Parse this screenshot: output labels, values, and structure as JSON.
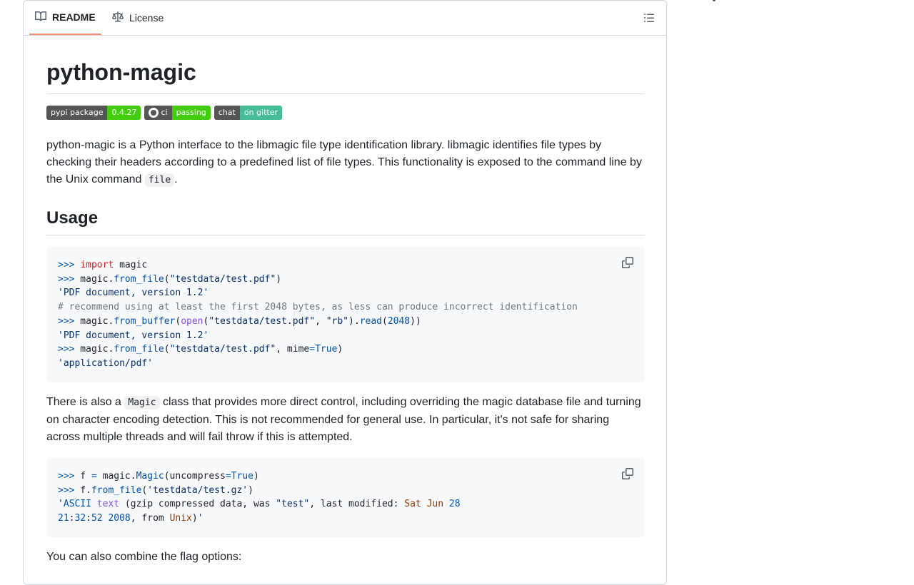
{
  "tabs": {
    "readme": {
      "label": "README",
      "icon": "book-icon"
    },
    "license": {
      "label": "License",
      "icon": "law-icon"
    },
    "outline_icon": "list-unordered-icon"
  },
  "readme": {
    "title": "python-magic",
    "badges": [
      {
        "left": "pypi package",
        "right": "0.4.27"
      },
      {
        "left": "ci",
        "right": "passing"
      },
      {
        "left": "chat",
        "right": "on gitter"
      }
    ],
    "intro_text": "python-magic is a Python interface to the libmagic file type identification library. libmagic identifies file types by checking their headers according to a predefined list of file types. This functionality is exposed to the command line by the Unix command ",
    "intro_code": "file",
    "intro_tail": ".",
    "usage_heading": "Usage",
    "code1": {
      "lines": [
        ">>> import magic",
        ">>> magic.from_file(\"testdata/test.pdf\")",
        "'PDF document, version 1.2'",
        "# recommend using at least the first 2048 bytes, as less can produce incorrect identification",
        ">>> magic.from_buffer(open(\"testdata/test.pdf\", \"rb\").read(2048))",
        "'PDF document, version 1.2'",
        ">>> magic.from_file(\"testdata/test.pdf\", mime=True)",
        "'application/pdf'"
      ]
    },
    "para2_pre": "There is also a ",
    "para2_code": "Magic",
    "para2_post": " class that provides more direct control, including overriding the magic database file and turning on character encoding detection. This is not recommended for general use. In particular, it's not safe for sharing across multiple threads and will fail throw if this is attempted.",
    "code2": {
      "lines": [
        ">>> f = magic.Magic(uncompress=True)",
        ">>> f.from_file('testdata/test.gz')",
        "'ASCII text (gzip compressed data, was \"test\", last modified: Sat Jun 28",
        "21:32:52 2008, from Unix)'"
      ]
    },
    "para3": "You can also combine the flag options:",
    "copy_icon": "copy-icon"
  }
}
